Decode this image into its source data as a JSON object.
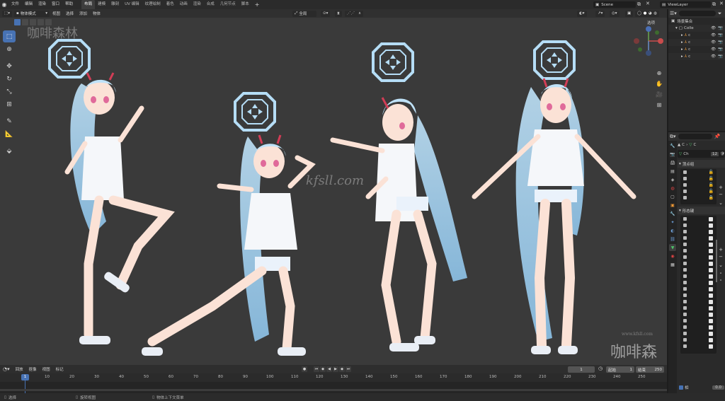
{
  "topbar": {
    "menus": [
      "文件",
      "编辑",
      "渲染",
      "窗口",
      "帮助"
    ],
    "workspaces": [
      "布局",
      "建模",
      "雕刻",
      "UV 编辑",
      "纹理绘制",
      "着色",
      "动画",
      "渲染",
      "合成",
      "几何节点",
      "脚本"
    ],
    "active_workspace": "布局",
    "add_tab": "+",
    "scene": "Scene",
    "view_layer": "ViewLayer"
  },
  "viewport_header": {
    "mode": "物体模式",
    "menus": [
      "视图",
      "选择",
      "添加",
      "物体"
    ],
    "orientation": "全局",
    "options": "选项"
  },
  "toolbar": {
    "tools": [
      "select-box",
      "cursor",
      "move",
      "rotate",
      "scale",
      "transform",
      "annotate",
      "measure",
      "add-cube"
    ]
  },
  "watermarks": {
    "top_left": "咖啡森林",
    "center": "kfsll.com",
    "bottom_right_url": "www.kfsll.com",
    "bottom_right_logo": "咖啡森林"
  },
  "timeline": {
    "menus": [
      "回放",
      "抠像",
      "视图",
      "标记"
    ],
    "current_frame": "1",
    "start_label": "起始",
    "start": "1",
    "end_label": "结束",
    "end": "250",
    "ticks": [
      "1",
      "10",
      "20",
      "30",
      "40",
      "50",
      "60",
      "70",
      "80",
      "90",
      "100",
      "110",
      "120",
      "130",
      "140",
      "150",
      "160",
      "170",
      "180",
      "190",
      "200",
      "210",
      "220",
      "230",
      "240",
      "250"
    ]
  },
  "statusbar": {
    "items": [
      "选择",
      "旋转视图",
      "物体上下文菜单"
    ]
  },
  "outliner": {
    "root": "场景集合",
    "collection": "Colle",
    "items": [
      "c",
      "c",
      "c",
      "c"
    ]
  },
  "properties": {
    "object_name": "C",
    "mesh_name": "Ch",
    "mesh_users": "12",
    "vertex_groups_title": "顶点组",
    "shape_keys_title": "形态键",
    "relative": "相",
    "value": "0.0"
  },
  "colors": {
    "accent": "#4772b3",
    "viewport_bg": "#3a3a3a",
    "hair": "#a9d4f2"
  }
}
